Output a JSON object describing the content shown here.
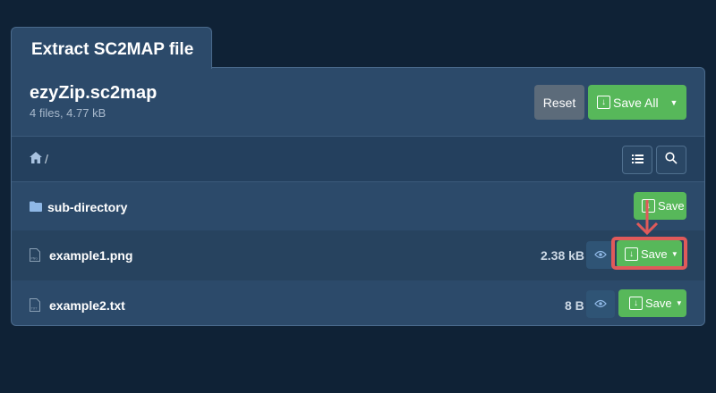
{
  "tab": {
    "title": "Extract SC2MAP file"
  },
  "archive": {
    "name": "ezyZip.sc2map",
    "meta": "4 files, 4.77 kB"
  },
  "toolbar": {
    "reset_label": "Reset",
    "save_all_label": "Save All"
  },
  "breadcrumb": {
    "path": "/"
  },
  "files": [
    {
      "name": "sub-directory",
      "type": "folder",
      "size": "",
      "save_label": "Save"
    },
    {
      "name": "example1.png",
      "type": "png",
      "size": "2.38 kB",
      "save_label": "Save"
    },
    {
      "name": "example2.txt",
      "type": "txt",
      "size": "8 B",
      "save_label": "Save"
    }
  ],
  "colors": {
    "background": "#0f2236",
    "panel": "#2c4a6a",
    "accent_green": "#57b85a",
    "highlight": "#e05a5a"
  },
  "icons": [
    "home-icon",
    "list-icon",
    "search-icon",
    "folder-icon",
    "file-png-icon",
    "file-txt-icon",
    "eye-icon",
    "download-icon",
    "caret-down-icon",
    "arrow-down-icon"
  ]
}
